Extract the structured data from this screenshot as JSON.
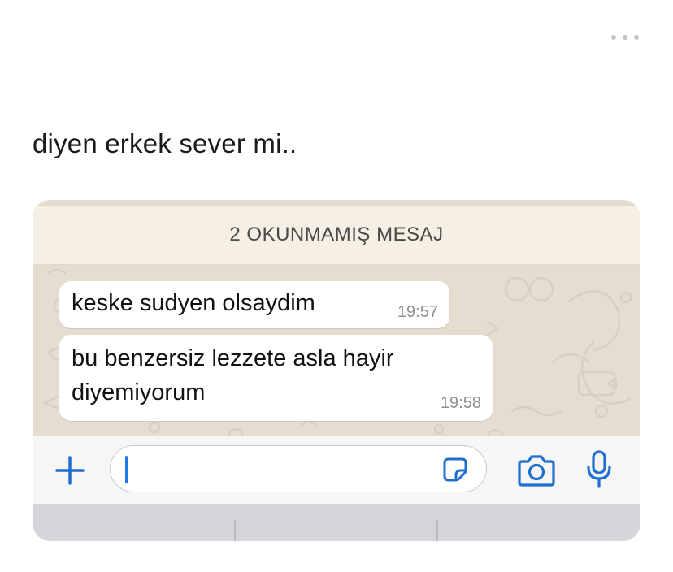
{
  "caption": "diyen erkek sever mi..",
  "more_icon": "ellipsis-icon",
  "chat": {
    "unread_banner": "2 OKUNMAMIŞ MESAJ",
    "messages": [
      {
        "text": "keske sudyen olsaydim",
        "time": "19:57"
      },
      {
        "text": "bu benzersiz lezzete asla hayir diyemiyorum",
        "time": "19:58"
      }
    ]
  },
  "input_bar": {
    "icons": {
      "add": "plus-icon",
      "sticker": "sticker-icon",
      "camera": "camera-icon",
      "microphone": "microphone-icon"
    },
    "accent_color": "#1f6fd1"
  },
  "colors": {
    "chat_background": "#e6ddd1",
    "banner_background": "#f7f0e5",
    "bubble": "#ffffff",
    "time_text": "#8e8e93"
  }
}
